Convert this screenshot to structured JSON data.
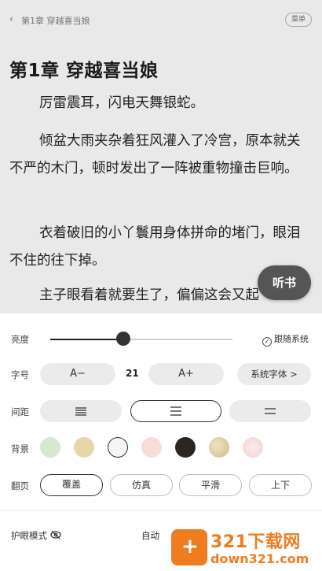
{
  "topbar": {
    "back_icon": "chevron-left-icon",
    "crumb": "第1章  穿越喜当娘",
    "menu_label": "菜单"
  },
  "chapter": {
    "title": "第1章  穿越喜当娘",
    "paragraphs": [
      "厉雷震耳，闪电天舞银蛇。",
      "倾盆大雨夹杂着狂风灌入了冷宫，原本就关不严的木门，顿时发出了一阵被重物撞击巨响。",
      "衣着破旧的小丫鬟用身体拼命的堵门，眼泪不住的往下掉。",
      "主子眼看着就要生了，偏偏这会又起"
    ]
  },
  "listen_button": "听书",
  "settings": {
    "brightness": {
      "label": "亮度",
      "value": 0.4,
      "follow_system": "跟随系统",
      "follow_system_checked": true
    },
    "font_size": {
      "label": "字号",
      "decrease": "A−",
      "value": "21",
      "increase": "A+",
      "font_family_button": "系统字体 >"
    },
    "spacing": {
      "label": "间距",
      "options": [
        "compact-spacing-icon",
        "medium-spacing-icon",
        "wide-spacing-icon"
      ],
      "selected": 1
    },
    "background": {
      "label": "背景",
      "swatches": [
        "#d7e8cf",
        "#e8d6ab",
        "#f5f5f5",
        "#f9dcd8",
        "#2b2522",
        "#d8c9a0",
        "#f6dede"
      ],
      "selected": 2
    },
    "page_turn": {
      "label": "翻页",
      "options": [
        "覆盖",
        "仿真",
        "平滑",
        "上下"
      ],
      "selected": 0
    },
    "eye_mode": "护眼模式",
    "auto_read": "自动"
  },
  "watermark": {
    "title": "321下载网",
    "sub": "down321.com"
  }
}
